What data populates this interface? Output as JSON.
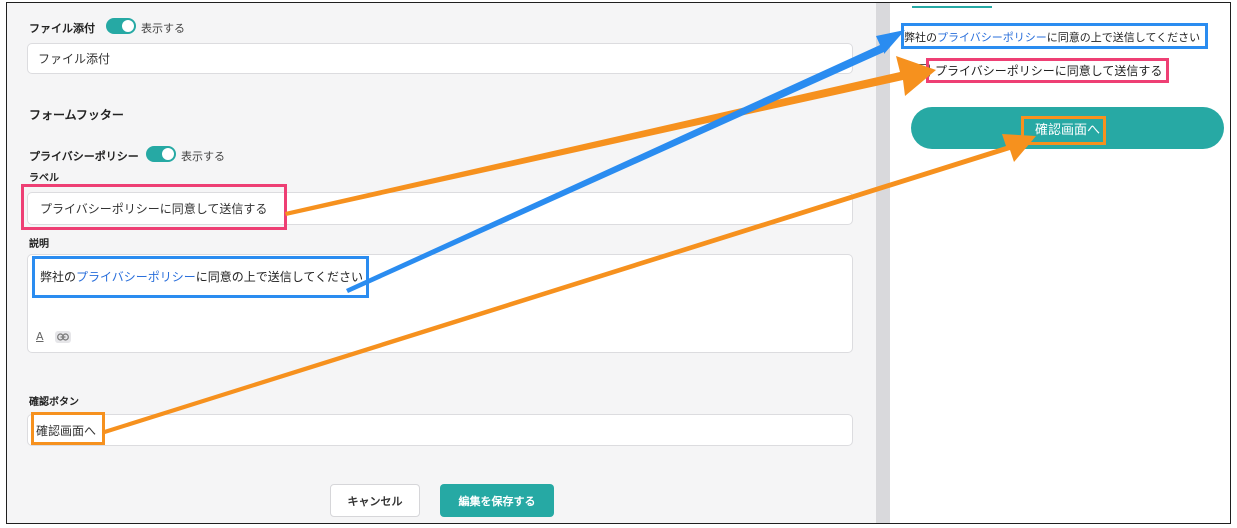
{
  "attachment": {
    "label": "ファイル添付",
    "toggle_text": "表示する",
    "input_value": "ファイル添付"
  },
  "footer": {
    "heading": "フォームフッター"
  },
  "privacy": {
    "label": "プライバシーポリシー",
    "toggle_text": "表示する",
    "label_caption": "ラベル",
    "label_value": "プライバシーポリシーに同意して送信する",
    "description_caption": "説明",
    "description_prefix": "弊社の",
    "description_link": "プライバシーポリシー",
    "description_suffix": "に同意の上で送信してください",
    "toolbar_text_icon": "A"
  },
  "confirm": {
    "caption": "確認ボタン",
    "value": "確認画面へ"
  },
  "actions": {
    "cancel_label": "キャンセル",
    "save_label": "編集を保存する"
  },
  "preview": {
    "description_prefix": "弊社の",
    "description_link": "プライバシーポリシー",
    "description_suffix": "に同意の上で送信してください",
    "checkbox_label": "プライバシーポリシーに同意して送信する",
    "confirm_button": "確認画面へ"
  },
  "colors": {
    "accent": "#26a9a4",
    "highlight_pink": "#ee3f74",
    "highlight_blue": "#2a8cf0",
    "highlight_orange": "#f6911e",
    "link": "#2a6fdb"
  },
  "icons": [
    "toggle-on-icon",
    "text-color-icon",
    "link-icon",
    "checkbox-icon"
  ]
}
